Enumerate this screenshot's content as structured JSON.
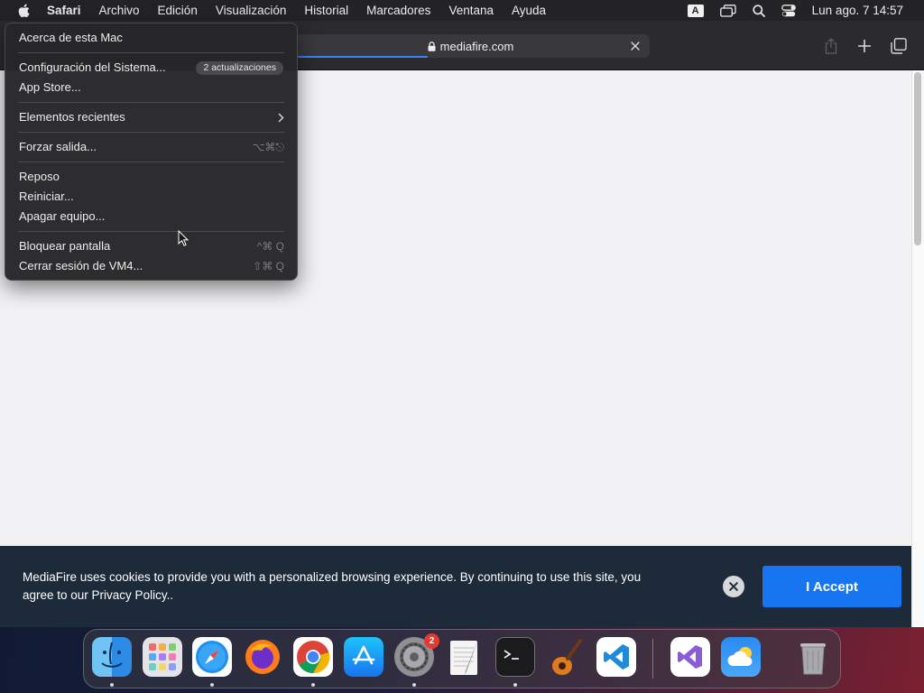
{
  "menubar": {
    "app_name": "Safari",
    "items": [
      "Archivo",
      "Edición",
      "Visualización",
      "Historial",
      "Marcadores",
      "Ventana",
      "Ayuda"
    ],
    "input_source": "A",
    "clock": "Lun ago. 7  14:57"
  },
  "browser": {
    "url": "mediafire.com"
  },
  "apple_menu": {
    "about": "Acerca de esta Mac",
    "system_settings": "Configuración del Sistema...",
    "updates_badge": "2 actualizaciones",
    "app_store": "App Store...",
    "recent_items": "Elementos recientes",
    "force_quit": "Forzar salida...",
    "force_quit_shortcut": "⌥⌘⎋",
    "sleep": "Reposo",
    "restart": "Reiniciar...",
    "shutdown": "Apagar equipo...",
    "lock_screen": "Bloquear pantalla",
    "lock_screen_shortcut": "^⌘ Q",
    "logout": "Cerrar sesión de VM4...",
    "logout_shortcut": "⇧⌘ Q"
  },
  "cookie_banner": {
    "text": "MediaFire uses cookies to provide you with a personalized browsing experience. By continuing to use this site, you agree to our Privacy Policy..",
    "accept_label": "I Accept"
  },
  "dock": {
    "apps": [
      "Finder",
      "Launchpad",
      "Safari",
      "Firefox",
      "Chrome",
      "App Store",
      "System Settings",
      "TextEdit",
      "Terminal",
      "GarageBand",
      "VS Code",
      "Visual Studio",
      "Weather",
      "Trash"
    ],
    "system_settings_badge": "2"
  },
  "colors": {
    "accent": "#1775f2",
    "cookie_bg": "#1d2a3a",
    "menu_bg": "#262628"
  }
}
